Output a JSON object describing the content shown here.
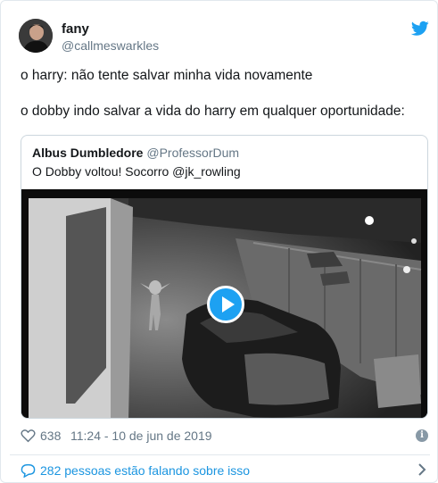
{
  "author": {
    "name": "fany",
    "handle": "@callmeswarkles"
  },
  "tweet": {
    "line1": "o harry: não tente salvar minha vida novamente",
    "line2": "o dobby indo salvar a vida do harry em qualquer oportunidade:"
  },
  "quoted": {
    "name": "Albus Dumbledore",
    "handle": "@ProfessorDum",
    "text": "O Dobby voltou! Socorro @jk_rowling"
  },
  "stats": {
    "likes": "638",
    "timestamp": "11:24 - 10 de jun de 2019"
  },
  "conversation": {
    "label": "282 pessoas estão falando sobre isso"
  },
  "icons": {
    "brand": "twitter-bird-icon",
    "like": "heart-icon",
    "info": "info-icon",
    "reply": "speech-bubble-icon",
    "open": "chevron-right-icon",
    "media": "play-icon"
  },
  "colors": {
    "brand": "#1da1f2",
    "link": "#1b95e0",
    "secondary_text": "#657786",
    "border": "#e1e8ed"
  }
}
